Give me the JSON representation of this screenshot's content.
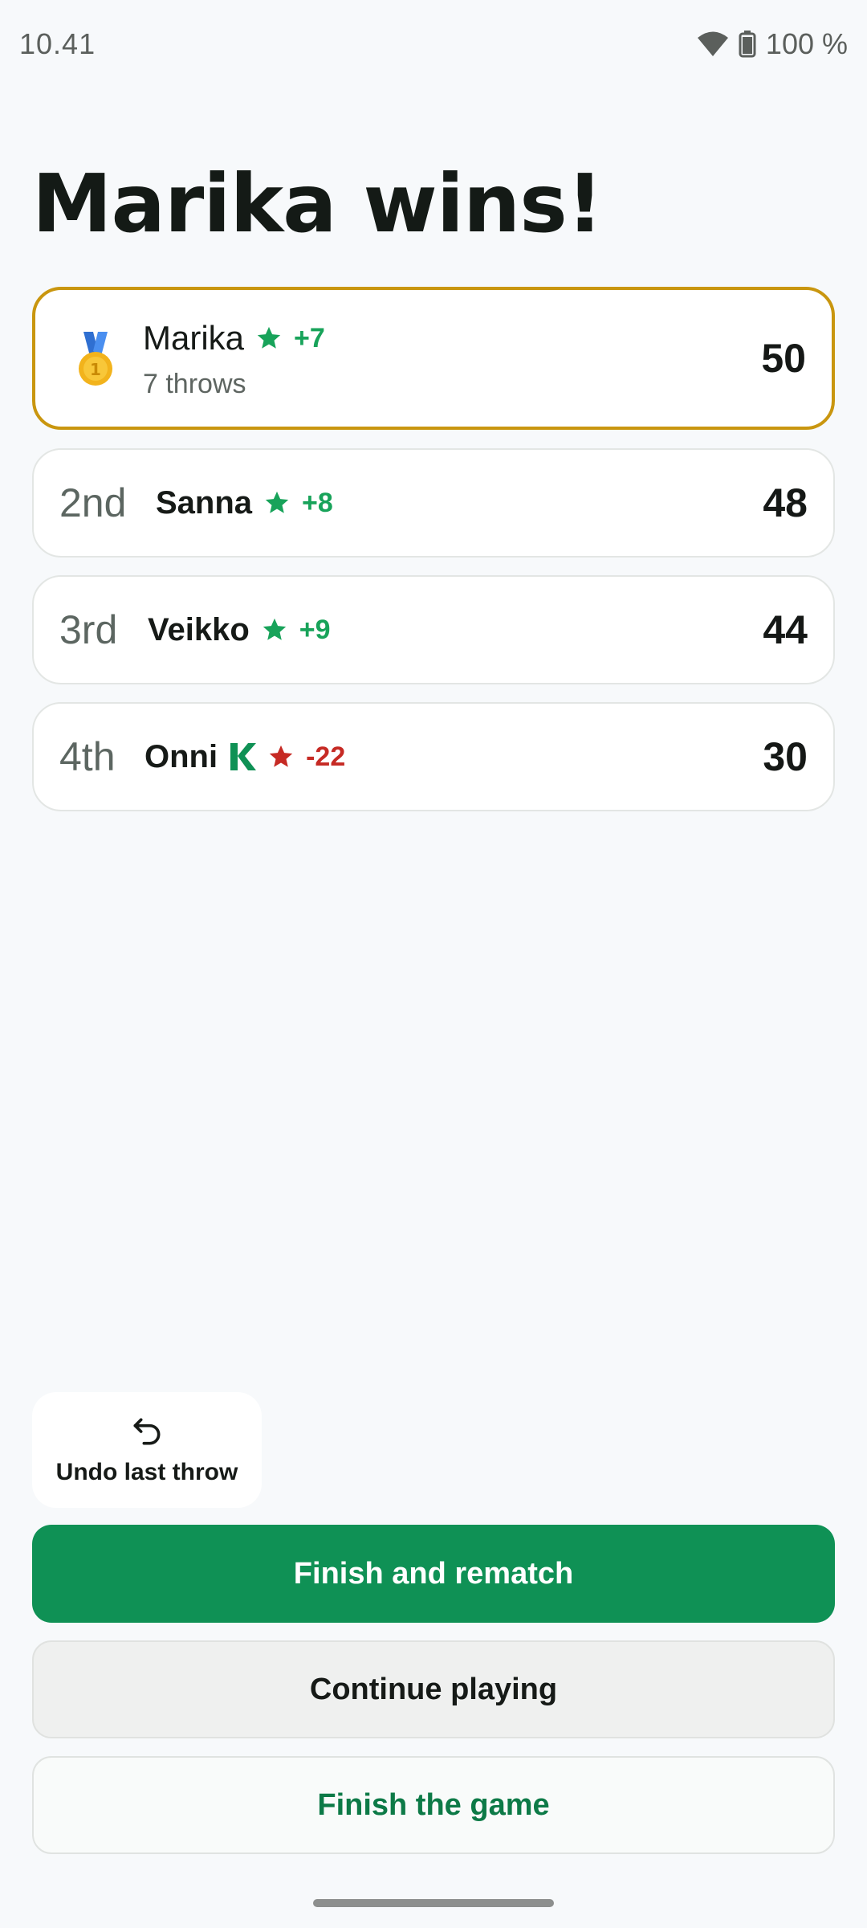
{
  "status_bar": {
    "time": "10.41",
    "battery": "100 %"
  },
  "title": "Marika wins!",
  "winner": {
    "name": "Marika",
    "delta": "+7",
    "throws": "7 throws",
    "score": "50"
  },
  "ranking": [
    {
      "rank": "2nd",
      "name": "Sanna",
      "delta": "+8",
      "score": "48"
    },
    {
      "rank": "3rd",
      "name": "Veikko",
      "delta": "+9",
      "score": "44"
    },
    {
      "rank": "4th",
      "name": "Onni",
      "badge": "K",
      "delta": "-22",
      "score": "30"
    }
  ],
  "undo": {
    "label": "Undo last throw"
  },
  "actions": {
    "finish_rematch": "Finish and rematch",
    "continue_playing": "Continue playing",
    "finish_game": "Finish the game"
  },
  "colors": {
    "accent_green": "#0f9155",
    "positive": "#18a35a",
    "negative": "#c62a24",
    "winner_border": "#c9960f"
  }
}
